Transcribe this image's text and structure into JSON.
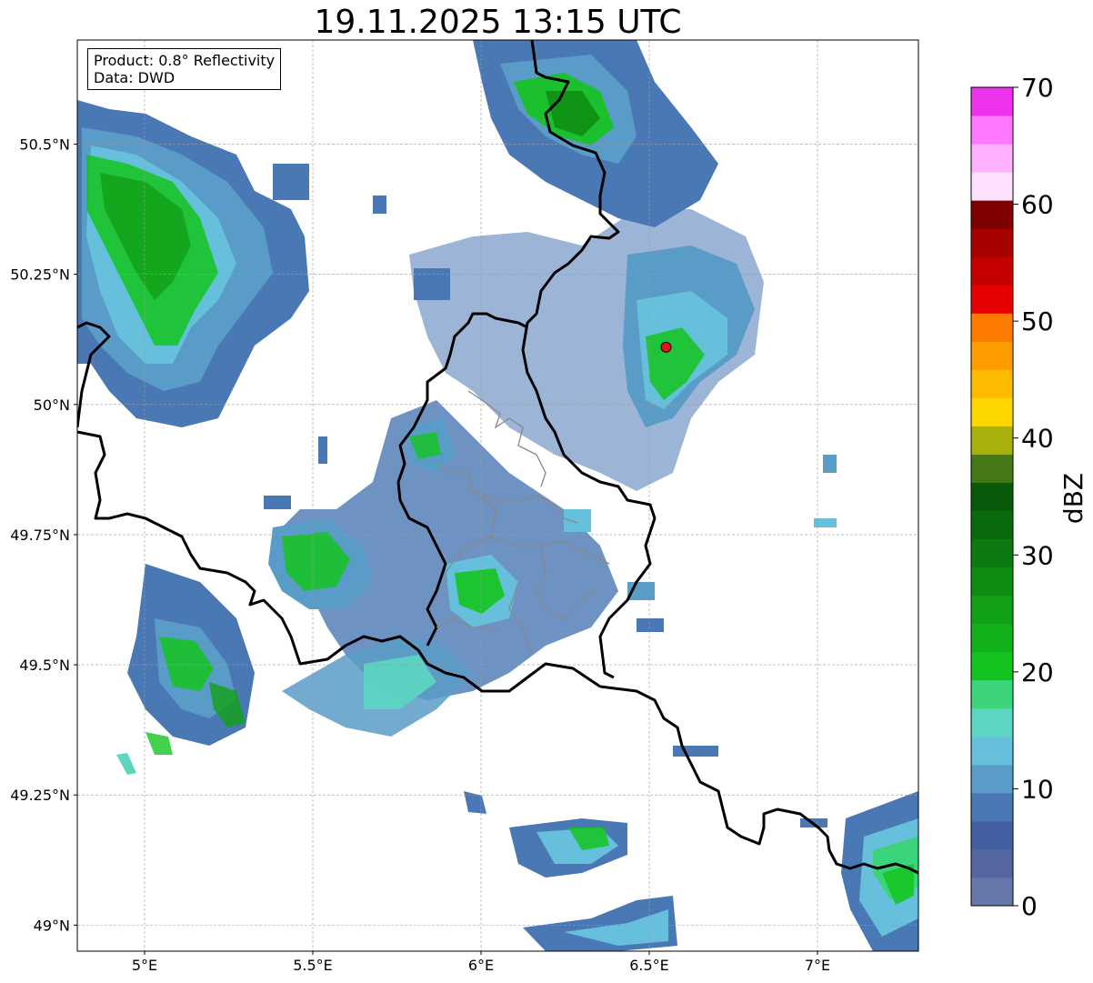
{
  "title": "19.11.2025 13:15 UTC",
  "info": {
    "product": "Product: 0.8° Reflectivity",
    "data": "Data: DWD"
  },
  "map": {
    "lon_range": [
      4.8,
      7.3
    ],
    "lat_range": [
      48.95,
      50.7
    ],
    "lon_ticks": [
      {
        "value": 5.0,
        "label": "5°E"
      },
      {
        "value": 5.5,
        "label": "5.5°E"
      },
      {
        "value": 6.0,
        "label": "6°E"
      },
      {
        "value": 6.5,
        "label": "6.5°E"
      },
      {
        "value": 7.0,
        "label": "7°E"
      }
    ],
    "lat_ticks": [
      {
        "value": 49.0,
        "label": "49°N"
      },
      {
        "value": 49.25,
        "label": "49.25°N"
      },
      {
        "value": 49.5,
        "label": "49.5°N"
      },
      {
        "value": 49.75,
        "label": "49.75°N"
      },
      {
        "value": 50.0,
        "label": "50°N"
      },
      {
        "value": 50.25,
        "label": "50.25°N"
      },
      {
        "value": 50.5,
        "label": "50.5°N"
      }
    ],
    "radar_site": {
      "lon": 6.55,
      "lat": 50.11,
      "color": "#e8101a"
    },
    "grid": true
  },
  "colorbar": {
    "unit": "dBZ",
    "range": [
      0,
      70
    ],
    "tick_labels": [
      "0",
      "10",
      "20",
      "30",
      "40",
      "50",
      "60",
      "70"
    ],
    "tick_values": [
      0,
      10,
      20,
      30,
      40,
      50,
      60,
      70
    ],
    "colors": [
      "#6677aa",
      "#5566a0",
      "#4460a4",
      "#4a78b4",
      "#5a9cc8",
      "#66c0dc",
      "#5cd6c0",
      "#3cd47a",
      "#14c41e",
      "#12b01a",
      "#12a016",
      "#0e8c12",
      "#0c7a10",
      "#0a6a0e",
      "#0a5a0c",
      "#467818",
      "#a8b00e",
      "#ffd700",
      "#ffbb00",
      "#ff9c00",
      "#ff7b00",
      "#e60000",
      "#c60000",
      "#a60000",
      "#7e0000",
      "#ffe0ff",
      "#ffb0ff",
      "#ff77ff",
      "#ee33ee"
    ]
  }
}
